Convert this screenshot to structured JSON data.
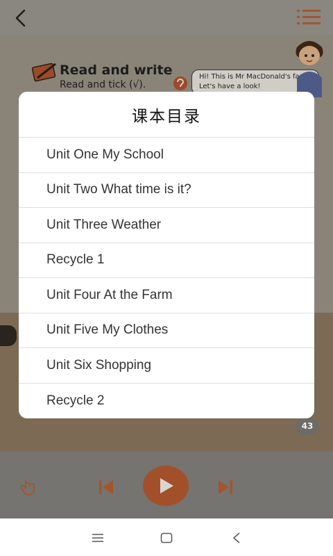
{
  "toolbar": {
    "back_icon": "chevron-left-icon",
    "menu_icon": "list-icon",
    "accent_color": "#c4541c"
  },
  "book_page": {
    "heading_title": "Read and write",
    "heading_subtitle": "Read and tick (√).",
    "speech_text": "Hi! This is Mr MacDonald's farm. Let's have a look!",
    "page_number": "43"
  },
  "dialog": {
    "title": "课本目录",
    "items": [
      {
        "label": "Unit One My School"
      },
      {
        "label": "Unit Two What time is it?"
      },
      {
        "label": "Unit Three Weather"
      },
      {
        "label": "Recycle 1"
      },
      {
        "label": "Unit Four At the Farm"
      },
      {
        "label": "Unit Five My Clothes"
      },
      {
        "label": "Unit Six Shopping"
      },
      {
        "label": "Recycle 2"
      }
    ]
  },
  "player": {
    "touch_icon": "hand-pointer-icon",
    "prev_icon": "skip-previous-icon",
    "play_icon": "play-icon",
    "next_icon": "skip-next-icon"
  },
  "navbar": {
    "menu_icon": "hamburger-icon",
    "home_icon": "square-home-icon",
    "back_icon": "triangle-back-icon"
  }
}
